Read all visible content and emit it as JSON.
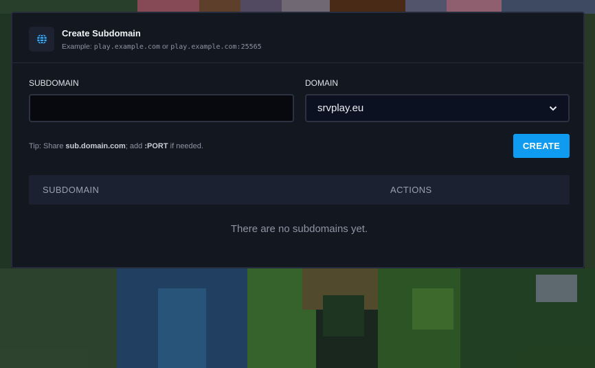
{
  "panel": {
    "title": "Create Subdomain",
    "example_prefix": "Example:",
    "example_1": "play.example.com",
    "example_or": "or",
    "example_2": "play.example.com:25565",
    "icon": "globe-icon"
  },
  "form": {
    "subdomain_label": "SUBDOMAIN",
    "subdomain_value": "",
    "domain_label": "DOMAIN",
    "domain_selected": "srvplay.eu",
    "tip_prefix": "Tip: Share",
    "tip_domain": "sub.domain.com",
    "tip_middle": "; add",
    "tip_port": ":PORT",
    "tip_suffix": "if needed.",
    "create_label": "CREATE"
  },
  "table": {
    "columns": [
      "SUBDOMAIN",
      "ACTIONS"
    ],
    "empty_message": "There are no subdomains yet."
  },
  "colors": {
    "accent": "#0e9bf0",
    "panel_bg": "#131720"
  }
}
